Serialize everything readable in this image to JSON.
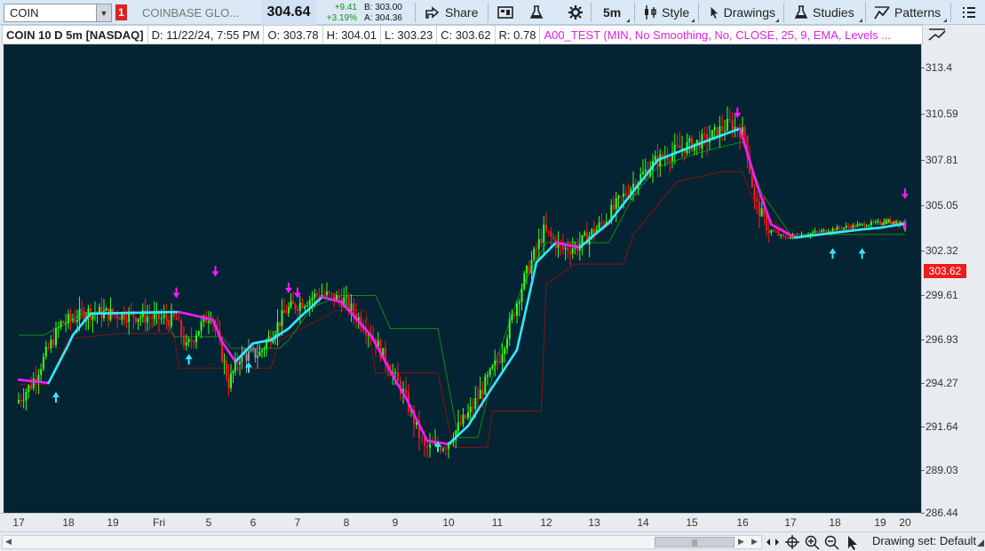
{
  "toolbar": {
    "symbol": "COIN",
    "alert_count": "1",
    "description": "COINBASE GLO...",
    "last_price": "304.64",
    "change_abs": "+9.41",
    "change_pct": "+3.19%",
    "bid": "B: 303.00",
    "ask": "A: 304.36",
    "share_label": "Share",
    "timeframe_label": "5m",
    "style_label": "Style",
    "drawings_label": "Drawings",
    "studies_label": "Studies",
    "patterns_label": "Patterns"
  },
  "infobar": {
    "symbol": "COIN 10 D 5m [NASDAQ]",
    "date": "D: 11/22/24, 7:55 PM",
    "open": "O: 303.78",
    "high": "H: 304.01",
    "low": "L: 303.23",
    "close": "C: 303.62",
    "range": "R: 0.78",
    "study": "A00_TEST (MIN, No Smoothing, No, CLOSE, 25, 9, EMA, Levels ..."
  },
  "colors": {
    "chart_bg": "#042433",
    "up_candle": "#39ff14",
    "down_candle": "#ff1a1a",
    "neutral_candle": "#9a9a9a",
    "ma_up": "#33e8ff",
    "ma_down": "#ff1aff",
    "band_fast": "#0e8a18",
    "band_slow": "#8a1010",
    "last_price_tag": "#ee1c1c"
  },
  "price_axis": {
    "ticks": [
      "313.4",
      "310.59",
      "307.81",
      "305.05",
      "302.32",
      "299.61",
      "296.93",
      "294.27",
      "291.64",
      "289.03",
      "286.44"
    ],
    "last_price": "303.62"
  },
  "time_axis": {
    "ticks": [
      "17",
      "18",
      "19",
      "Fri",
      "5",
      "6",
      "7",
      "8",
      "9",
      "10",
      "11",
      "12",
      "13",
      "14",
      "15",
      "16",
      "17",
      "18",
      "19",
      "20"
    ]
  },
  "chart_data": {
    "type": "candlestick",
    "series": [
      {
        "name": "COIN 10 D 5m",
        "type": "candlestick"
      },
      {
        "name": "A00_TEST",
        "type": "line"
      }
    ],
    "ylim": [
      286.44,
      314.8
    ],
    "price_path": [
      [
        0,
        293.1
      ],
      [
        0.3,
        294.2
      ],
      [
        0.9,
        297.9
      ],
      [
        1.5,
        298.6
      ],
      [
        2.5,
        298.4
      ],
      [
        3.4,
        298.1
      ],
      [
        3.6,
        296.4
      ],
      [
        3.8,
        297.4
      ],
      [
        4.1,
        298.6
      ],
      [
        4.25,
        297.1
      ],
      [
        4.5,
        294.3
      ],
      [
        4.75,
        295.9
      ],
      [
        5.2,
        296.1
      ],
      [
        5.8,
        298.7
      ],
      [
        6.5,
        299.7
      ],
      [
        7.0,
        299.3
      ],
      [
        7.6,
        297.1
      ],
      [
        8.2,
        293.7
      ],
      [
        8.6,
        290.3
      ],
      [
        9.0,
        290.6
      ],
      [
        9.5,
        292.6
      ],
      [
        10.1,
        295.9
      ],
      [
        10.6,
        300.6
      ],
      [
        11.0,
        303.5
      ],
      [
        11.4,
        302.4
      ],
      [
        11.7,
        302.6
      ],
      [
        12.2,
        303.9
      ],
      [
        12.8,
        306.2
      ],
      [
        13.3,
        307.7
      ],
      [
        13.8,
        308.5
      ],
      [
        14.3,
        309.0
      ],
      [
        14.8,
        310.0
      ],
      [
        15.1,
        309.3
      ],
      [
        15.3,
        305.3
      ],
      [
        15.6,
        303.6
      ],
      [
        15.9,
        303.1
      ],
      [
        16.4,
        303.3
      ],
      [
        17.0,
        303.6
      ],
      [
        17.7,
        303.9
      ],
      [
        18.4,
        304.1
      ],
      [
        19.1,
        303.9
      ],
      [
        19.45,
        303.6
      ]
    ],
    "ma_path": [
      [
        0,
        294.5
      ],
      [
        0.6,
        294.3
      ],
      [
        1.1,
        297.2
      ],
      [
        1.5,
        298.5
      ],
      [
        3.4,
        298.6
      ],
      [
        3.7,
        298.4
      ],
      [
        4.1,
        298.1
      ],
      [
        4.3,
        296.8
      ],
      [
        4.6,
        295.6
      ],
      [
        5.0,
        296.7
      ],
      [
        5.4,
        296.9
      ],
      [
        5.8,
        297.6
      ],
      [
        6.5,
        299.5
      ],
      [
        6.9,
        299.2
      ],
      [
        7.5,
        297.2
      ],
      [
        8.2,
        293.4
      ],
      [
        8.6,
        290.8
      ],
      [
        9.0,
        290.6
      ],
      [
        9.4,
        291.7
      ],
      [
        9.8,
        293.6
      ],
      [
        10.4,
        296.3
      ],
      [
        10.8,
        301.6
      ],
      [
        11.2,
        302.8
      ],
      [
        11.7,
        302.5
      ],
      [
        12.3,
        304.0
      ],
      [
        12.8,
        305.9
      ],
      [
        13.3,
        307.8
      ],
      [
        13.9,
        308.5
      ],
      [
        14.5,
        309.2
      ],
      [
        14.95,
        309.7
      ],
      [
        15.3,
        306.3
      ],
      [
        15.6,
        303.9
      ],
      [
        16.1,
        303.1
      ],
      [
        16.7,
        303.3
      ],
      [
        17.6,
        303.6
      ],
      [
        18.4,
        303.8
      ],
      [
        19.2,
        304.0
      ],
      [
        19.45,
        303.6
      ]
    ],
    "green_band": [
      [
        0,
        297.2
      ],
      [
        0.5,
        297.2
      ],
      [
        0.9,
        297.8
      ],
      [
        1.3,
        298.5
      ],
      [
        3.1,
        298.6
      ],
      [
        3.3,
        297.1
      ],
      [
        4.3,
        297.1
      ],
      [
        4.5,
        296.4
      ],
      [
        5.6,
        296.4
      ],
      [
        5.8,
        296.9
      ],
      [
        6.3,
        298.9
      ],
      [
        6.9,
        299.6
      ],
      [
        7.6,
        299.6
      ],
      [
        7.9,
        297.6
      ],
      [
        8.8,
        297.6
      ],
      [
        9.2,
        291.0
      ],
      [
        9.6,
        291.0
      ],
      [
        10.0,
        295.9
      ],
      [
        10.5,
        300.1
      ],
      [
        11.0,
        302.8
      ],
      [
        12.3,
        302.8
      ],
      [
        12.8,
        305.6
      ],
      [
        13.3,
        307.4
      ],
      [
        14.2,
        308.3
      ],
      [
        15.0,
        308.9
      ],
      [
        15.4,
        305.8
      ],
      [
        16.0,
        303.3
      ],
      [
        19.45,
        303.3
      ]
    ],
    "red_band": [
      [
        0,
        294.2
      ],
      [
        0.6,
        294.2
      ],
      [
        1.0,
        297.0
      ],
      [
        2.2,
        297.3
      ],
      [
        3.3,
        297.3
      ],
      [
        3.4,
        295.2
      ],
      [
        5.4,
        295.2
      ],
      [
        5.6,
        296.9
      ],
      [
        6.8,
        298.7
      ],
      [
        7.4,
        298.7
      ],
      [
        7.6,
        294.9
      ],
      [
        8.8,
        294.9
      ],
      [
        9.1,
        290.4
      ],
      [
        9.8,
        290.4
      ],
      [
        9.9,
        292.6
      ],
      [
        10.9,
        292.6
      ],
      [
        11.0,
        300.3
      ],
      [
        11.6,
        301.5
      ],
      [
        12.6,
        301.5
      ],
      [
        12.8,
        303.3
      ],
      [
        13.7,
        306.5
      ],
      [
        14.6,
        307.1
      ],
      [
        15.0,
        307.1
      ],
      [
        15.3,
        304.8
      ],
      [
        16.0,
        303.3
      ],
      [
        19.45,
        303.3
      ]
    ],
    "up_arrows": [
      [
        0.75,
        294.3
      ],
      [
        3.6,
        296.6
      ],
      [
        4.9,
        296.1
      ],
      [
        8.8,
        291.3
      ],
      [
        16.95,
        303.0
      ],
      [
        17.6,
        303.0
      ]
    ],
    "down_arrows": [
      [
        3.35,
        298.9
      ],
      [
        4.15,
        300.2
      ],
      [
        5.8,
        299.2
      ],
      [
        6.0,
        298.9
      ],
      [
        14.9,
        309.8
      ],
      [
        19.4,
        304.9
      ]
    ]
  }
}
